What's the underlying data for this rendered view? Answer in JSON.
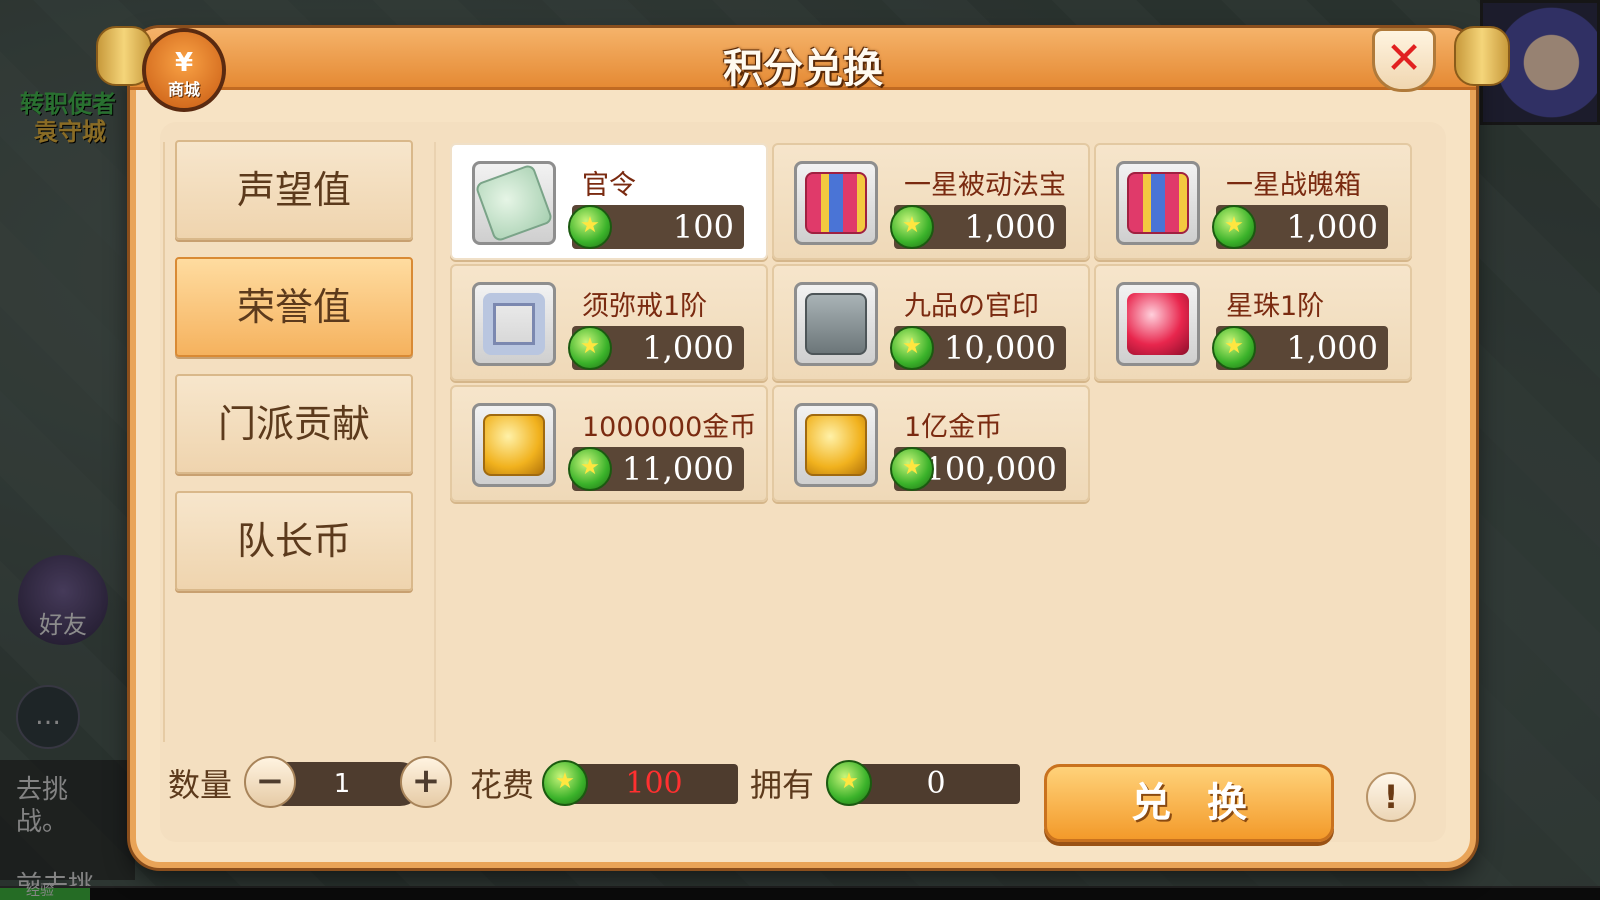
{
  "background": {
    "npc_name": "转职使者",
    "npc_location": "袁守城",
    "friend_label": "好友",
    "chat_lines": [
      "去挑战。",
      "前去挑战。"
    ],
    "exp_label": "经验"
  },
  "header": {
    "title": "积分兑换",
    "shop_badge_symbol": "¥",
    "shop_badge_label": "商城",
    "close_symbol": "✕"
  },
  "tabs": [
    {
      "label": "声望值",
      "active": false
    },
    {
      "label": "荣誉值",
      "active": true
    },
    {
      "label": "门派贡献",
      "active": false
    },
    {
      "label": "队长币",
      "active": false
    }
  ],
  "items": [
    {
      "name": "官令",
      "price": "100",
      "icon": "jade-token-icon",
      "selected": true
    },
    {
      "name": "一星被动法宝",
      "price": "1,000",
      "icon": "gift-box-icon",
      "selected": false
    },
    {
      "name": "一星战魄箱",
      "price": "1,000",
      "icon": "gift-box-icon",
      "selected": false
    },
    {
      "name": "须弥戒1阶",
      "price": "1,000",
      "icon": "ring-icon",
      "selected": false
    },
    {
      "name": "九品の官印",
      "price": "10,000",
      "icon": "official-seal-icon",
      "selected": false
    },
    {
      "name": "星珠1阶",
      "price": "1,000",
      "icon": "star-orb-icon",
      "selected": false
    },
    {
      "name": "1000000金币",
      "price": "11,000",
      "icon": "gold-coin-icon",
      "selected": false
    },
    {
      "name": "1亿金币",
      "price": "1,100,000",
      "icon": "gold-coin-icon",
      "selected": false
    }
  ],
  "footer": {
    "quantity_label": "数量",
    "quantity_value": "1",
    "minus_symbol": "−",
    "plus_symbol": "+",
    "cost_label": "花费",
    "cost_value": "100",
    "own_label": "拥有",
    "own_value": "0",
    "exchange_label": "兑换",
    "info_symbol": "!"
  },
  "colors": {
    "accent": "#f39a2a",
    "cost_text": "#ff3030",
    "item_name": "#7a2a10"
  }
}
